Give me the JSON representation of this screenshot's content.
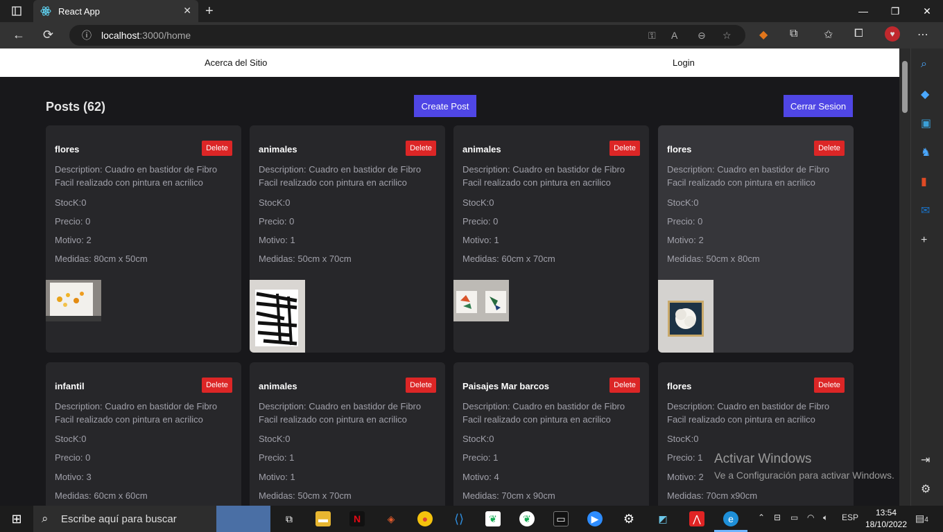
{
  "browser": {
    "tab_title": "React App",
    "url_host": "localhost",
    "url_path": ":3000/home"
  },
  "nav": {
    "about": "Acerca del Sitio",
    "login": "Login"
  },
  "header": {
    "title": "Posts (62)",
    "create_button": "Create Post",
    "logout_button": "Cerrar Sesion"
  },
  "card_labels": {
    "delete": "Delete"
  },
  "posts": [
    {
      "title": "flores",
      "description": "Description: Cuadro en bastidor de Fibro Facil realizado con pintura en acrilico",
      "stock": "StocK:0",
      "precio": "Precio: 0",
      "motivo": "Motivo: 2",
      "medidas": "Medidas: 80cm x 50cm"
    },
    {
      "title": "animales",
      "description": "Description: Cuadro en bastidor de Fibro Facil realizado con pintura en acrilico",
      "stock": "StocK:0",
      "precio": "Precio: 0",
      "motivo": "Motivo: 1",
      "medidas": "Medidas: 50cm x 70cm"
    },
    {
      "title": "animales",
      "description": "Description: Cuadro en bastidor de Fibro Facil realizado con pintura en acrilico",
      "stock": "StocK:0",
      "precio": "Precio: 0",
      "motivo": "Motivo: 1",
      "medidas": "Medidas: 60cm x 70cm"
    },
    {
      "title": "flores",
      "description": "Description: Cuadro en bastidor de Fibro Facil realizado con pintura en acrilico",
      "stock": "StocK:0",
      "precio": "Precio: 0",
      "motivo": "Motivo: 2",
      "medidas": "Medidas: 50cm x 80cm"
    },
    {
      "title": "infantil",
      "description": "Description: Cuadro en bastidor de Fibro Facil realizado con pintura en acrilico",
      "stock": "StocK:0",
      "precio": "Precio: 0",
      "motivo": "Motivo: 3",
      "medidas": "Medidas: 60cm x 60cm"
    },
    {
      "title": "animales",
      "description": "Description: Cuadro en bastidor de Fibro Facil realizado con pintura en acrilico",
      "stock": "StocK:0",
      "precio": "Precio: 1",
      "motivo": "Motivo: 1",
      "medidas": "Medidas: 50cm x 70cm"
    },
    {
      "title": "Paisajes Mar barcos",
      "description": "Description: Cuadro en bastidor de Fibro Facil realizado con pintura en acrilico",
      "stock": "StocK:0",
      "precio": "Precio: 1",
      "motivo": "Motivo: 4",
      "medidas": "Medidas: 70cm x 90cm"
    },
    {
      "title": "flores",
      "description": "Description: Cuadro en bastidor de Fibro Facil realizado con pintura en acrilico",
      "stock": "StocK:0",
      "precio": "Precio: 1",
      "motivo": "Motivo: 2",
      "medidas": "Medidas: 70cm x90cm"
    }
  ],
  "watermark": {
    "line1": "Activar Windows",
    "line2": "Ve a Configuración para activar Windows."
  },
  "taskbar": {
    "search_placeholder": "Escribe aquí para buscar",
    "lang": "ESP",
    "time": "13:54",
    "date": "18/10/2022",
    "notifications": "4"
  },
  "colors": {
    "accent": "#4f46e5",
    "danger": "#dc2626",
    "card": "#27272a",
    "page_bg": "#18181b"
  }
}
